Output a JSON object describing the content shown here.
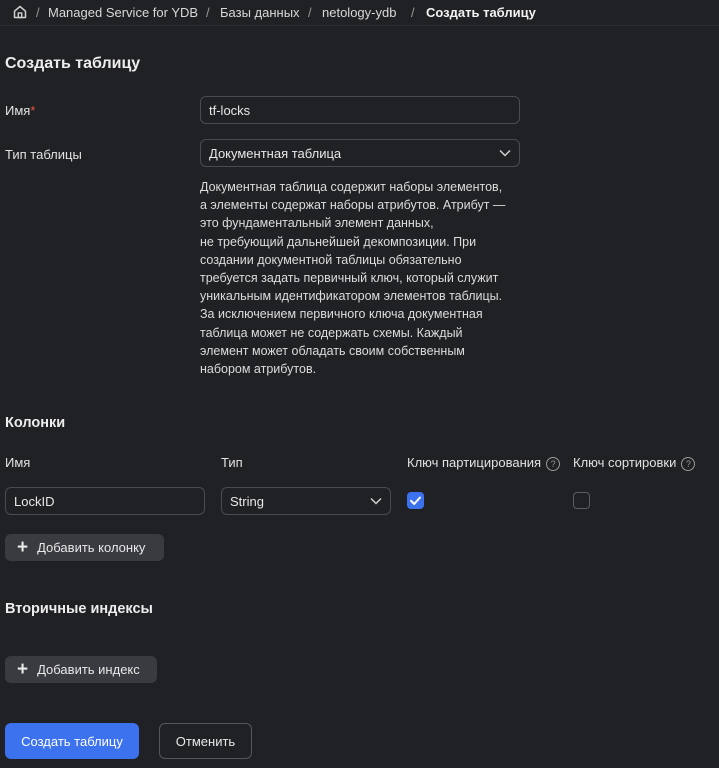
{
  "breadcrumbs": {
    "items": [
      "Managed Service for YDB",
      "Базы данных",
      "netology-ydb"
    ],
    "current": "Создать таблицу",
    "separator": "/"
  },
  "form": {
    "title": "Создать таблицу",
    "name_label": "Имя",
    "required_mark": "*",
    "name_value": "tf-locks",
    "type_label": "Тип таблицы",
    "type_value": "Документная таблица",
    "type_description": [
      "Документная таблица содержит наборы элементов,",
      "а элементы содержат наборы атрибутов. Атрибут —",
      "это фундаментальный элемент данных,",
      "не требующий дальнейшей декомпозиции. При",
      "создании документной таблицы обязательно",
      "требуется задать первичный ключ, который служит",
      "уникальным идентификатором элементов таблицы.",
      "За исключением первичного ключа документная",
      "таблица может не содержать схемы. Каждый",
      "элемент может обладать своим собственным",
      "набором атрибутов."
    ]
  },
  "columns": {
    "heading": "Колонки",
    "headers": {
      "name": "Имя",
      "type": "Тип",
      "partition_key": "Ключ партицирования",
      "sort_key": "Ключ сортировки"
    },
    "help_glyph": "?",
    "rows": [
      {
        "name": "LockID",
        "type": "String",
        "partition_key": true,
        "sort_key": false
      }
    ],
    "add_button": "Добавить колонку",
    "add_icon": "+"
  },
  "indexes": {
    "heading": "Вторичные индексы",
    "add_button": "Добавить индекс",
    "add_icon": "+"
  },
  "actions": {
    "create": "Создать таблицу",
    "cancel": "Отменить"
  },
  "colors": {
    "background": "#202124",
    "accent": "#3d72ee",
    "required": "#e5534b"
  }
}
